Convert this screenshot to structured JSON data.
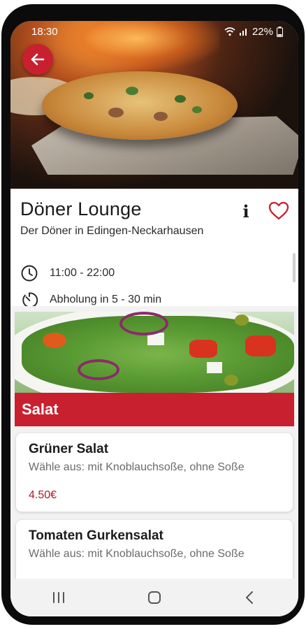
{
  "status": {
    "time": "18:30",
    "battery": "22%"
  },
  "restaurant": {
    "name": "Döner Lounge",
    "tagline": "Der Döner in Edingen-Neckarhausen",
    "hours": "11:00 - 22:00",
    "pickup": "Abholung in 5 - 30 min",
    "info_glyph": "i"
  },
  "category": {
    "name": "Salat"
  },
  "items": [
    {
      "name": "Grüner Salat",
      "desc": "Wähle aus: mit Knoblauchsoße, ohne Soße",
      "price": "4.50€"
    },
    {
      "name": "Tomaten Gurkensalat",
      "desc": "Wähle aus: mit Knoblauchsoße, ohne Soße"
    }
  ],
  "icons": {
    "back": "arrow-left-icon",
    "info": "info-icon",
    "favorite": "heart-outline-icon",
    "hours": "clock-icon",
    "pickup": "timer-icon",
    "nav_recents": "recents-icon",
    "nav_home": "home-icon",
    "nav_back": "nav-back-icon"
  },
  "colors": {
    "accent": "#c8202f",
    "price": "#b3182a"
  }
}
